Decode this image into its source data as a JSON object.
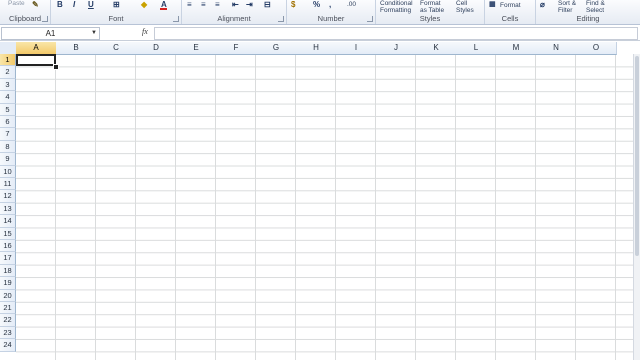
{
  "ribbon": {
    "groups": {
      "clipboard": "Clipboard",
      "font": "Font",
      "alignment": "Alignment",
      "number": "Number",
      "styles": "Styles",
      "cells": "Cells",
      "editing": "Editing"
    },
    "buttons": {
      "paste": "Paste",
      "bold": "B",
      "italic": "I",
      "underline": "U",
      "percent": "%",
      "comma": ",",
      "conditional_formatting_1": "Conditional",
      "conditional_formatting_2": "Formatting",
      "format_as_table_1": "Format",
      "format_as_table_2": "as Table",
      "cell_styles_1": "Cell",
      "cell_styles_2": "Styles",
      "format": "Format",
      "sort_filter_1": "Sort &",
      "sort_filter_2": "Filter",
      "find_select_1": "Find &",
      "find_select_2": "Select"
    },
    "colors": {
      "font_color": "#d42020",
      "fill_color": "#ffeb3b"
    }
  },
  "formula_bar": {
    "name_box": "A1",
    "fx_label": "fx",
    "formula": ""
  },
  "grid": {
    "columns": [
      "A",
      "B",
      "C",
      "D",
      "E",
      "F",
      "G",
      "H",
      "I",
      "J",
      "K",
      "L",
      "M",
      "N",
      "O"
    ],
    "rows": [
      "1",
      "2",
      "3",
      "4",
      "5",
      "6",
      "7",
      "8",
      "9",
      "10",
      "11",
      "12",
      "13",
      "14",
      "15",
      "16",
      "17",
      "18",
      "19",
      "20",
      "21",
      "22",
      "23",
      "24"
    ],
    "active_cell": "A1"
  }
}
